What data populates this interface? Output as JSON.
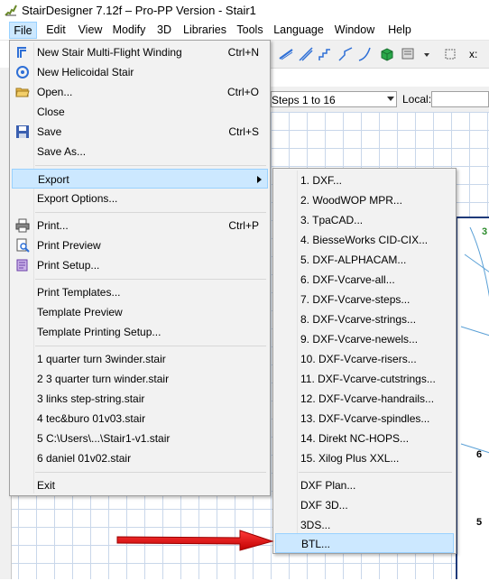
{
  "window": {
    "title": "StairDesigner 7.12f – Pro-PP Version - Stair1"
  },
  "menubar": {
    "items": [
      {
        "label": "File"
      },
      {
        "label": "Edit"
      },
      {
        "label": "View"
      },
      {
        "label": "Modify"
      },
      {
        "label": "3D"
      },
      {
        "label": "Libraries"
      },
      {
        "label": "Tools"
      },
      {
        "label": "Language"
      },
      {
        "label": "Window"
      },
      {
        "label": "Help"
      }
    ]
  },
  "toolbar": {
    "steps_combo_value": "Steps 1 to 16",
    "local_label": "Local:",
    "x_label": "x:"
  },
  "file_menu": {
    "new_multiflight": {
      "label": "New Stair Multi-Flight Winding",
      "shortcut": "Ctrl+N"
    },
    "new_helicoidal": {
      "label": "New Helicoidal Stair"
    },
    "open": {
      "label": "Open...",
      "shortcut": "Ctrl+O"
    },
    "close": {
      "label": "Close"
    },
    "save": {
      "label": "Save",
      "shortcut": "Ctrl+S"
    },
    "save_as": {
      "label": "Save As..."
    },
    "export": {
      "label": "Export"
    },
    "export_options": {
      "label": "Export Options..."
    },
    "print": {
      "label": "Print...",
      "shortcut": "Ctrl+P"
    },
    "print_preview": {
      "label": "Print Preview"
    },
    "print_setup": {
      "label": "Print Setup..."
    },
    "print_templates": {
      "label": "Print Templates..."
    },
    "template_preview": {
      "label": "Template Preview"
    },
    "template_printing_setup": {
      "label": "Template Printing Setup..."
    },
    "recent": [
      {
        "label": "1 quarter turn 3winder.stair"
      },
      {
        "label": "2 3 quarter turn winder.stair"
      },
      {
        "label": "3 links step-string.stair"
      },
      {
        "label": "4 tec&buro 01v03.stair"
      },
      {
        "label": "5 C:\\Users\\...\\Stair1-v1.stair"
      },
      {
        "label": "6 daniel 01v02.stair"
      }
    ],
    "exit": {
      "label": "Exit"
    }
  },
  "export_menu": {
    "items": [
      {
        "label": "1. DXF..."
      },
      {
        "label": "2. WoodWOP MPR..."
      },
      {
        "label": "3. TpaCAD..."
      },
      {
        "label": "4. BiesseWorks CID-CIX..."
      },
      {
        "label": "5. DXF-ALPHACAM..."
      },
      {
        "label": "6. DXF-Vcarve-all..."
      },
      {
        "label": "7. DXF-Vcarve-steps..."
      },
      {
        "label": "8. DXF-Vcarve-strings..."
      },
      {
        "label": "9. DXF-Vcarve-newels..."
      },
      {
        "label": "10. DXF-Vcarve-risers..."
      },
      {
        "label": "11. DXF-Vcarve-cutstrings..."
      },
      {
        "label": "12. DXF-Vcarve-handrails..."
      },
      {
        "label": "13. DXF-Vcarve-spindles..."
      },
      {
        "label": "14. Direkt NC-HOPS..."
      },
      {
        "label": "15. Xilog Plus XXL..."
      }
    ],
    "dxf_plan": {
      "label": "DXF Plan..."
    },
    "dxf_3d": {
      "label": "DXF 3D..."
    },
    "three_ds": {
      "label": "3DS..."
    },
    "btl": {
      "label": "BTL..."
    }
  },
  "canvas": {
    "labels": [
      "3",
      "6",
      "5"
    ]
  },
  "colors": {
    "highlight": "#cce8ff",
    "highlight_border": "#99d1ff",
    "menu_bg": "#f2f2f2",
    "arrow": "#e01010"
  }
}
